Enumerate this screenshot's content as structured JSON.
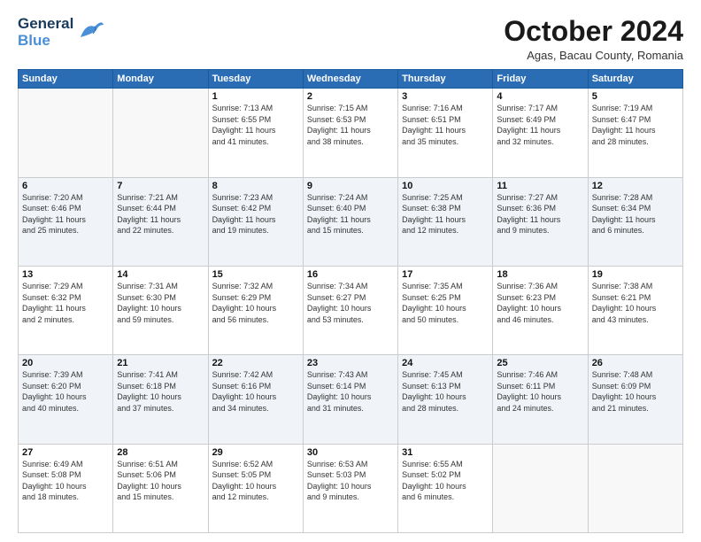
{
  "header": {
    "logo_line1": "General",
    "logo_line2": "Blue",
    "month": "October 2024",
    "location": "Agas, Bacau County, Romania"
  },
  "weekdays": [
    "Sunday",
    "Monday",
    "Tuesday",
    "Wednesday",
    "Thursday",
    "Friday",
    "Saturday"
  ],
  "weeks": [
    [
      {
        "day": "",
        "info": ""
      },
      {
        "day": "",
        "info": ""
      },
      {
        "day": "1",
        "info": "Sunrise: 7:13 AM\nSunset: 6:55 PM\nDaylight: 11 hours\nand 41 minutes."
      },
      {
        "day": "2",
        "info": "Sunrise: 7:15 AM\nSunset: 6:53 PM\nDaylight: 11 hours\nand 38 minutes."
      },
      {
        "day": "3",
        "info": "Sunrise: 7:16 AM\nSunset: 6:51 PM\nDaylight: 11 hours\nand 35 minutes."
      },
      {
        "day": "4",
        "info": "Sunrise: 7:17 AM\nSunset: 6:49 PM\nDaylight: 11 hours\nand 32 minutes."
      },
      {
        "day": "5",
        "info": "Sunrise: 7:19 AM\nSunset: 6:47 PM\nDaylight: 11 hours\nand 28 minutes."
      }
    ],
    [
      {
        "day": "6",
        "info": "Sunrise: 7:20 AM\nSunset: 6:46 PM\nDaylight: 11 hours\nand 25 minutes."
      },
      {
        "day": "7",
        "info": "Sunrise: 7:21 AM\nSunset: 6:44 PM\nDaylight: 11 hours\nand 22 minutes."
      },
      {
        "day": "8",
        "info": "Sunrise: 7:23 AM\nSunset: 6:42 PM\nDaylight: 11 hours\nand 19 minutes."
      },
      {
        "day": "9",
        "info": "Sunrise: 7:24 AM\nSunset: 6:40 PM\nDaylight: 11 hours\nand 15 minutes."
      },
      {
        "day": "10",
        "info": "Sunrise: 7:25 AM\nSunset: 6:38 PM\nDaylight: 11 hours\nand 12 minutes."
      },
      {
        "day": "11",
        "info": "Sunrise: 7:27 AM\nSunset: 6:36 PM\nDaylight: 11 hours\nand 9 minutes."
      },
      {
        "day": "12",
        "info": "Sunrise: 7:28 AM\nSunset: 6:34 PM\nDaylight: 11 hours\nand 6 minutes."
      }
    ],
    [
      {
        "day": "13",
        "info": "Sunrise: 7:29 AM\nSunset: 6:32 PM\nDaylight: 11 hours\nand 2 minutes."
      },
      {
        "day": "14",
        "info": "Sunrise: 7:31 AM\nSunset: 6:30 PM\nDaylight: 10 hours\nand 59 minutes."
      },
      {
        "day": "15",
        "info": "Sunrise: 7:32 AM\nSunset: 6:29 PM\nDaylight: 10 hours\nand 56 minutes."
      },
      {
        "day": "16",
        "info": "Sunrise: 7:34 AM\nSunset: 6:27 PM\nDaylight: 10 hours\nand 53 minutes."
      },
      {
        "day": "17",
        "info": "Sunrise: 7:35 AM\nSunset: 6:25 PM\nDaylight: 10 hours\nand 50 minutes."
      },
      {
        "day": "18",
        "info": "Sunrise: 7:36 AM\nSunset: 6:23 PM\nDaylight: 10 hours\nand 46 minutes."
      },
      {
        "day": "19",
        "info": "Sunrise: 7:38 AM\nSunset: 6:21 PM\nDaylight: 10 hours\nand 43 minutes."
      }
    ],
    [
      {
        "day": "20",
        "info": "Sunrise: 7:39 AM\nSunset: 6:20 PM\nDaylight: 10 hours\nand 40 minutes."
      },
      {
        "day": "21",
        "info": "Sunrise: 7:41 AM\nSunset: 6:18 PM\nDaylight: 10 hours\nand 37 minutes."
      },
      {
        "day": "22",
        "info": "Sunrise: 7:42 AM\nSunset: 6:16 PM\nDaylight: 10 hours\nand 34 minutes."
      },
      {
        "day": "23",
        "info": "Sunrise: 7:43 AM\nSunset: 6:14 PM\nDaylight: 10 hours\nand 31 minutes."
      },
      {
        "day": "24",
        "info": "Sunrise: 7:45 AM\nSunset: 6:13 PM\nDaylight: 10 hours\nand 28 minutes."
      },
      {
        "day": "25",
        "info": "Sunrise: 7:46 AM\nSunset: 6:11 PM\nDaylight: 10 hours\nand 24 minutes."
      },
      {
        "day": "26",
        "info": "Sunrise: 7:48 AM\nSunset: 6:09 PM\nDaylight: 10 hours\nand 21 minutes."
      }
    ],
    [
      {
        "day": "27",
        "info": "Sunrise: 6:49 AM\nSunset: 5:08 PM\nDaylight: 10 hours\nand 18 minutes."
      },
      {
        "day": "28",
        "info": "Sunrise: 6:51 AM\nSunset: 5:06 PM\nDaylight: 10 hours\nand 15 minutes."
      },
      {
        "day": "29",
        "info": "Sunrise: 6:52 AM\nSunset: 5:05 PM\nDaylight: 10 hours\nand 12 minutes."
      },
      {
        "day": "30",
        "info": "Sunrise: 6:53 AM\nSunset: 5:03 PM\nDaylight: 10 hours\nand 9 minutes."
      },
      {
        "day": "31",
        "info": "Sunrise: 6:55 AM\nSunset: 5:02 PM\nDaylight: 10 hours\nand 6 minutes."
      },
      {
        "day": "",
        "info": ""
      },
      {
        "day": "",
        "info": ""
      }
    ]
  ]
}
